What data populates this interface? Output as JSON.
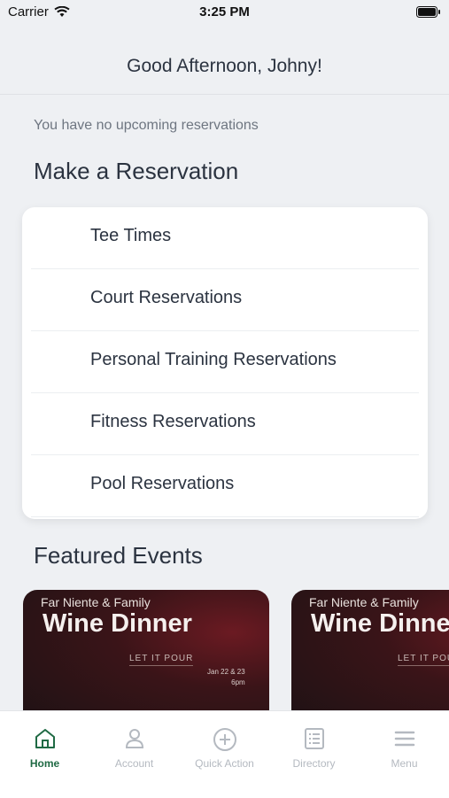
{
  "status_bar": {
    "carrier": "Carrier",
    "time": "3:25 PM"
  },
  "header": {
    "greeting": "Good Afternoon, Johny!"
  },
  "reservations": {
    "empty_message": "You have no upcoming reservations",
    "section_title": "Make a Reservation",
    "items": [
      {
        "label": "Tee Times"
      },
      {
        "label": "Court Reservations"
      },
      {
        "label": "Personal Training Reservations"
      },
      {
        "label": "Fitness Reservations"
      },
      {
        "label": "Pool Reservations"
      }
    ]
  },
  "events": {
    "section_title": "Featured Events",
    "cards": [
      {
        "subtitle": "Far Niente & Family",
        "title": "Wine Dinner",
        "tagline": "LET IT POUR",
        "date": "Jan 22 & 23",
        "time": "6pm"
      },
      {
        "subtitle": "Far Niente & Family",
        "title": "Wine Dinner",
        "tagline": "LET IT POUR"
      }
    ]
  },
  "tab_bar": {
    "active_color": "#1f6a44",
    "inactive_color": "#b4b9c0",
    "tabs": [
      {
        "label": "Home",
        "icon": "home-icon"
      },
      {
        "label": "Account",
        "icon": "user-icon"
      },
      {
        "label": "Quick Action",
        "icon": "plus-circle-icon"
      },
      {
        "label": "Directory",
        "icon": "list-icon"
      },
      {
        "label": "Menu",
        "icon": "hamburger-icon"
      }
    ]
  }
}
